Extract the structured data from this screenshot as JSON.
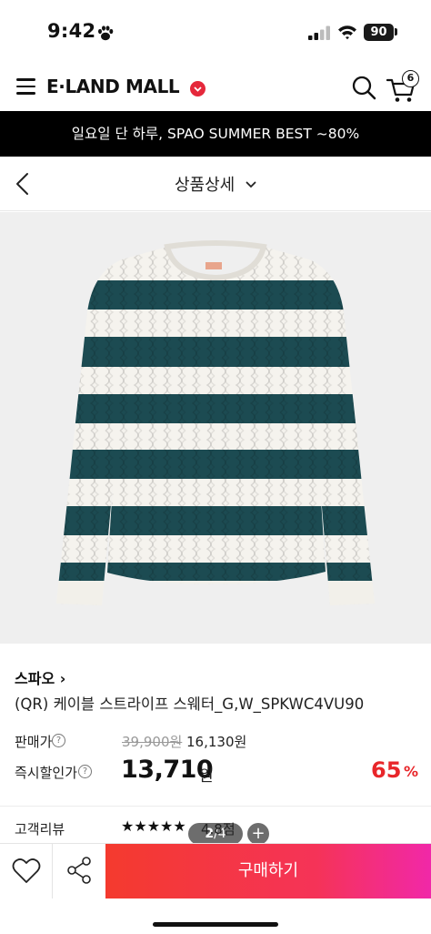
{
  "status_bar": {
    "time": "9:42",
    "battery": "90"
  },
  "header": {
    "logo": "E·LAND MALL",
    "cart_count": "6"
  },
  "promo": {
    "text": "일요일 단 하루, SPAO SUMMER BEST ~80%"
  },
  "sub_header": {
    "title": "상품상세"
  },
  "gallery": {
    "current": "2",
    "total": "/4",
    "zoom": "+"
  },
  "product": {
    "brand": "스파오 ›",
    "name": "(QR) 케이블 스트라이프 스웨터_G,W_SPKWC4VU90"
  },
  "price": {
    "label_sale": "판매가",
    "original": "39,900원",
    "sale": "16,130원",
    "label_instant": "즉시할인가",
    "final": "13,710",
    "final_unit": "원",
    "discount": "65",
    "discount_unit": "%"
  },
  "review": {
    "label": "고객리뷰",
    "stars": "★★★★★",
    "score": "4.8점"
  },
  "actions": {
    "buy": "구매하기"
  },
  "colors": {
    "buy_start": "#f43a2e",
    "buy_end": "#f128a8",
    "discount": "#e8262a",
    "stripe": "#1c4b52"
  }
}
